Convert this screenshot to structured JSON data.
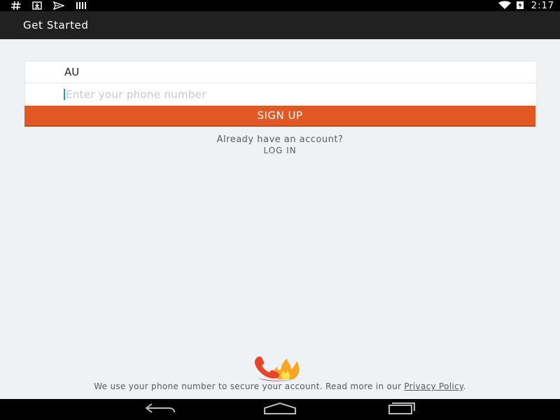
{
  "status_bar": {
    "left_icons": [
      "hash-icon",
      "download-icon",
      "send-icon",
      "signal-bars-icon"
    ],
    "right_icons": [
      "wifi-icon",
      "battery-charging-icon"
    ],
    "time": "2:17"
  },
  "app_bar": {
    "title": "Get Started"
  },
  "form": {
    "country_code": "AU",
    "phone": {
      "value": "",
      "placeholder": "Enter your phone number"
    },
    "signup_label": "SIGN UP"
  },
  "login": {
    "prompt": "Already have an account?",
    "link_label": "LOG IN"
  },
  "footer": {
    "text": "We use your phone number to secure your account. Read more in our ",
    "privacy_link": "Privacy Policy",
    "text_end": ".",
    "logo_icon": "phone-flame-logo-icon"
  },
  "nav_bar": {
    "buttons": [
      "back-icon",
      "home-icon",
      "recents-icon"
    ]
  },
  "colors": {
    "accent": "#e25824",
    "background": "#eff2f5",
    "app_bar": "#212121",
    "caret": "#21a395"
  }
}
